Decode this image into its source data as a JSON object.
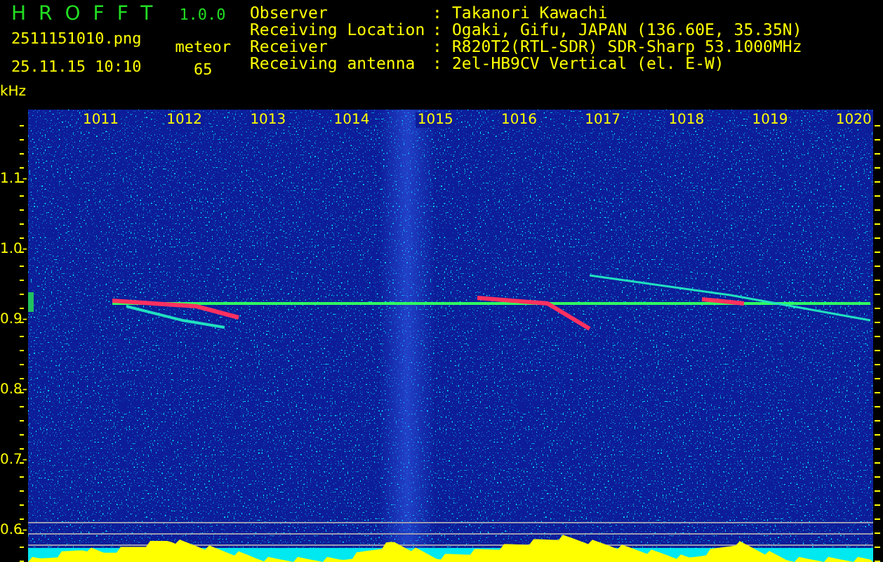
{
  "app": {
    "name": "HROFFT",
    "version": "1.0.0"
  },
  "file": "2511151010.png",
  "datetime": "25.11.15 10:10",
  "mode": {
    "label": "meteor",
    "count": "65"
  },
  "info": [
    {
      "label": "Observer",
      "separator": ":",
      "value": "Takanori Kawachi"
    },
    {
      "label": "Receiving Location",
      "separator": ":",
      "value": "Ogaki, Gifu, JAPAN (136.60E, 35.35N)"
    },
    {
      "label": "Receiver",
      "separator": ":",
      "value": "R820T2(RTL-SDR) SDR-Sharp 53.1000MHz"
    },
    {
      "label": "Receiving antenna",
      "separator": ":",
      "value": "2el-HB9CV Vertical (el. E-W)"
    }
  ],
  "spectrogram": {
    "y_unit": "kHz",
    "x_labels": [
      "1011",
      "1012",
      "1013",
      "1014",
      "1015",
      "1016",
      "1017",
      "1018",
      "1019",
      "1020"
    ],
    "y_labels": [
      "1.1-",
      "1.0-",
      "0.9-",
      "0.8-",
      "0.7-",
      "0.6-"
    ]
  }
}
